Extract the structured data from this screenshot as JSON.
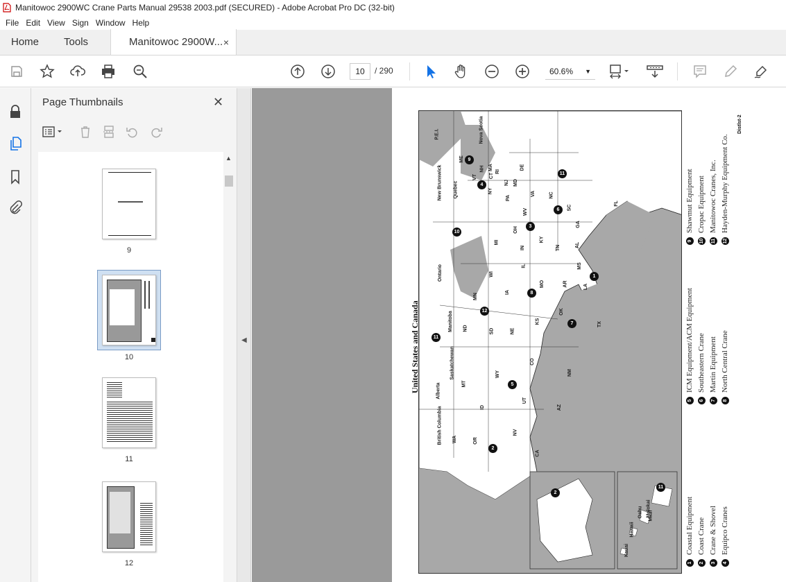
{
  "window": {
    "title": "Manitowoc 2900WC Crane Parts Manual 29538 2003.pdf (SECURED) - Adobe Acrobat Pro DC (32-bit)"
  },
  "menu": [
    "File",
    "Edit",
    "View",
    "Sign",
    "Window",
    "Help"
  ],
  "tabs": {
    "home": "Home",
    "tools": "Tools",
    "doc": "Manitowoc 2900W...",
    "close": "×"
  },
  "toolbar": {
    "page_current": "10",
    "page_total": "/ 290",
    "zoom": "60.6%"
  },
  "panel": {
    "title": "Page Thumbnails",
    "close": "✕"
  },
  "thumbnails": [
    {
      "label": "9"
    },
    {
      "label": "10",
      "selected": true
    },
    {
      "label": "11"
    },
    {
      "label": "12"
    }
  ],
  "document": {
    "map_title": "United States and Canada",
    "page_ref": "Distlst-2",
    "provinces": [
      "Nova Scotia",
      "P.E.I.",
      "New Brunswick",
      "Quebec",
      "Ontario",
      "Manitoba",
      "Saskatchewan",
      "Alberta",
      "British Columbia"
    ],
    "states": [
      "ME",
      "VT",
      "NH",
      "MA",
      "CT",
      "RI",
      "NY",
      "PA",
      "NJ",
      "DE",
      "MD",
      "VA",
      "WV",
      "NC",
      "SC",
      "GA",
      "FL",
      "OH",
      "MI",
      "IN",
      "KY",
      "TN",
      "AL",
      "MS",
      "IL",
      "WI",
      "MN",
      "IA",
      "MO",
      "AR",
      "LA",
      "TX",
      "OK",
      "KS",
      "NE",
      "SD",
      "ND",
      "MT",
      "WY",
      "CO",
      "NM",
      "AZ",
      "UT",
      "ID",
      "WA",
      "OR",
      "NV",
      "CA"
    ],
    "inset_labels": [
      "Hawaii",
      "Kauai",
      "Oahu",
      "Molokai",
      "Maui"
    ],
    "legend": [
      {
        "n": "1",
        "name": "Coastal Equipment"
      },
      {
        "n": "2",
        "name": "Coast Crane"
      },
      {
        "n": "3",
        "name": "Crane & Shovel"
      },
      {
        "n": "4",
        "name": "Equipco Cranes"
      },
      {
        "n": "5",
        "name": "ICM Equipment/ACM Equipment"
      },
      {
        "n": "6",
        "name": "Southeastern Crane"
      },
      {
        "n": "7",
        "name": "Martin Equipment"
      },
      {
        "n": "8",
        "name": "North Central Crane"
      },
      {
        "n": "9",
        "name": "Shawmut Equipment"
      },
      {
        "n": "10",
        "name": "Cropac Equipment"
      },
      {
        "n": "11",
        "name": "Manitowoc Cranes, Inc."
      },
      {
        "n": "12",
        "name": "Hayden-Murphy Equipment Co."
      }
    ]
  }
}
